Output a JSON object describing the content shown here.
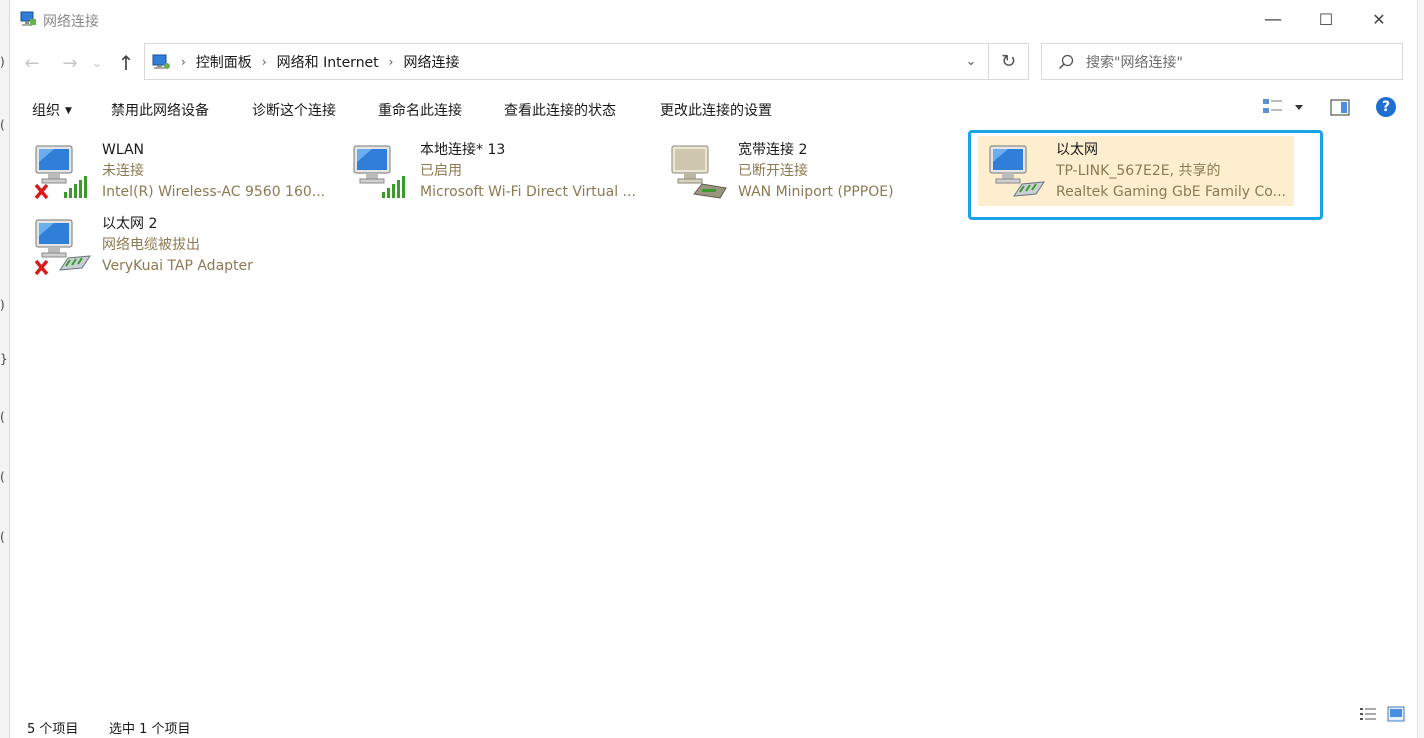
{
  "window": {
    "title": "网络连接",
    "minimize_glyph": "—",
    "maximize_glyph": "☐",
    "close_glyph": "✕"
  },
  "nav": {
    "back_glyph": "←",
    "forward_glyph": "→",
    "recent_glyph": "⌄",
    "up_glyph": "↑",
    "refresh_glyph": "↻",
    "dropdown_glyph": "⌄"
  },
  "breadcrumb": {
    "items": [
      "控制面板",
      "网络和 Internet",
      "网络连接"
    ],
    "separator": "›"
  },
  "search": {
    "placeholder": "搜索\"网络连接\""
  },
  "toolbar": {
    "organize": "组织",
    "disable": "禁用此网络设备",
    "diagnose": "诊断这个连接",
    "rename": "重命名此连接",
    "view_status": "查看此连接的状态",
    "change_settings": "更改此连接的设置",
    "help_glyph": "?"
  },
  "connections": [
    {
      "name": "WLAN",
      "status": "未连接",
      "device": "Intel(R) Wireless-AC 9560 160...",
      "icon": "wifi-adapter-disconnected-icon"
    },
    {
      "name": "本地连接* 13",
      "status": "已启用",
      "device": "Microsoft Wi-Fi Direct Virtual ...",
      "icon": "wifi-adapter-icon"
    },
    {
      "name": "宽带连接 2",
      "status": "已断开连接",
      "device": "WAN Miniport (PPPOE)",
      "icon": "broadband-modem-icon"
    },
    {
      "name": "以太网",
      "status": "TP-LINK_567E2E, 共享的",
      "device": "Realtek Gaming GbE Family Co...",
      "icon": "ethernet-adapter-icon"
    },
    {
      "name": "以太网 2",
      "status": "网络电缆被拔出",
      "device": "VeryKuai TAP Adapter",
      "icon": "ethernet-adapter-disconnected-icon"
    }
  ],
  "statusbar": {
    "count": "5 个项目",
    "selected": "选中 1 个项目"
  },
  "colors": {
    "selection_bg": "#fdeecf",
    "focus_ring": "#1aa3e8",
    "secondary_text": "#8d7a53"
  }
}
